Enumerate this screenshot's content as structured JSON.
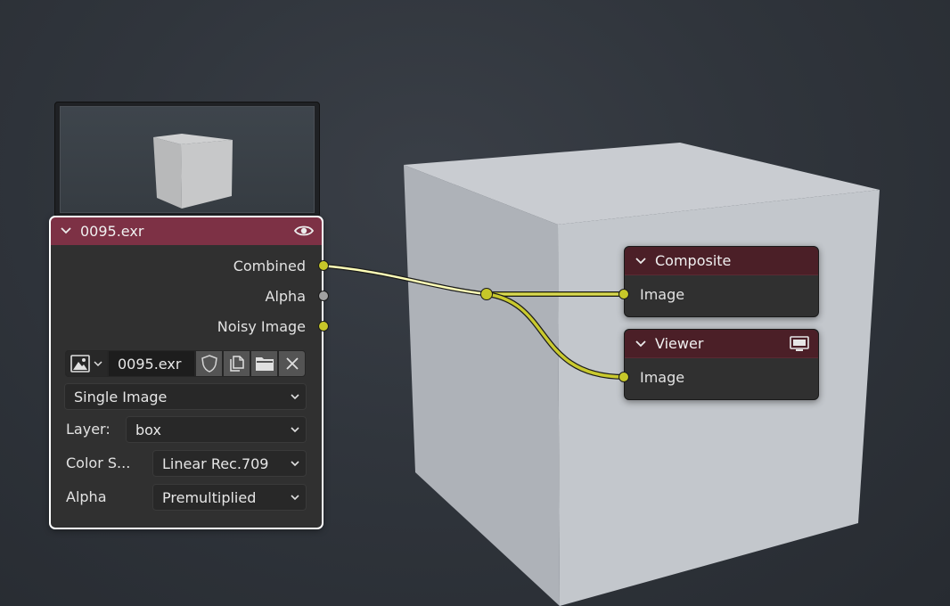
{
  "image_node": {
    "title": "0095.exr",
    "header_color": "#7d3145",
    "outputs": [
      {
        "label": "Combined",
        "socket_color": "#c7c729",
        "connected": true
      },
      {
        "label": "Alpha",
        "socket_color": "#a1a1a1",
        "connected": false
      },
      {
        "label": "Noisy Image",
        "socket_color": "#c7c729",
        "connected": false
      }
    ],
    "image_name": "0095.exr",
    "source": "Single Image",
    "layer_label": "Layer:",
    "layer_value": "box",
    "colorspace_label": "Color S...",
    "colorspace_value": "Linear Rec.709",
    "alpha_label": "Alpha",
    "alpha_value": "Premultiplied",
    "toolbar_icons": [
      "image-browse-icon",
      "fake-user-shield-icon",
      "duplicate-icon",
      "open-folder-icon",
      "unlink-x-icon"
    ]
  },
  "composite_node": {
    "title": "Composite",
    "header_color": "#4b1f27",
    "inputs": [
      {
        "label": "Image",
        "socket_color": "#c7c729"
      }
    ]
  },
  "viewer_node": {
    "title": "Viewer",
    "header_color": "#4b1f27",
    "inputs": [
      {
        "label": "Image",
        "socket_color": "#c7c729"
      }
    ],
    "icon": "monitor-icon"
  },
  "reroute": {
    "color": "#c7c729"
  },
  "colors": {
    "link_active": "#ffffb0",
    "link": "#c7c729",
    "backdrop_cube": "#c4c8cd"
  }
}
